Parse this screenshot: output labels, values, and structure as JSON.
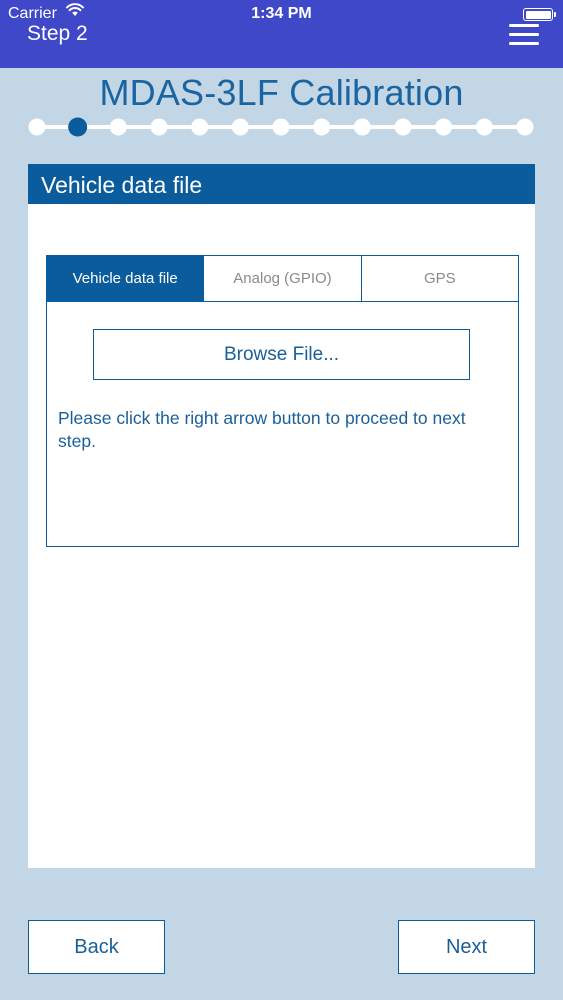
{
  "status_bar": {
    "carrier": "Carrier",
    "time": "1:34 PM",
    "wifi_icon": "wifi-icon",
    "battery_icon": "battery-icon"
  },
  "nav_bar": {
    "step_label": "Step 2",
    "menu_icon": "hamburger-menu-icon",
    "background_color": "#3f48c8"
  },
  "page": {
    "title": "MDAS-3LF Calibration",
    "title_color": "#1b64a2",
    "background_color": "#c3d6e6"
  },
  "progress": {
    "total_steps": 13,
    "current_step": 2,
    "active_color": "#0b5c9c",
    "inactive_color": "#ffffff"
  },
  "section": {
    "header": "Vehicle data file",
    "header_color": "#0b5c9c"
  },
  "tabs": [
    {
      "label": "Vehicle data file",
      "active": true
    },
    {
      "label": "Analog (GPIO)",
      "active": false
    },
    {
      "label": "GPS",
      "active": false
    }
  ],
  "panel": {
    "browse_label": "Browse File...",
    "instructions": "Please click the right arrow button to proceed to next step."
  },
  "footer": {
    "back_label": "Back",
    "next_label": "Next"
  }
}
